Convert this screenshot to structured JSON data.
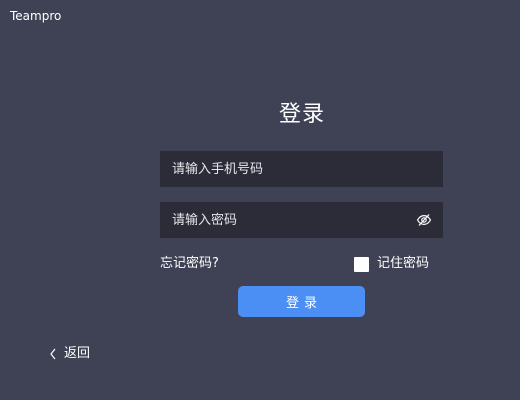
{
  "window": {
    "app_title": "Teampro"
  },
  "login": {
    "title": "登录",
    "phone_placeholder": "请输入手机号码",
    "phone_value": "",
    "password_placeholder": "请输入密码",
    "password_value": "",
    "password_toggle_icon": "eye-slash-icon",
    "forgot_password": "忘记密码?",
    "remember_password": "记住密码",
    "remember_checked": false,
    "submit_label": "登录"
  },
  "footer": {
    "back_icon": "chevron-left-icon",
    "back_label": "返回"
  },
  "colors": {
    "background": "#3f4254",
    "input_background": "#2c2c39",
    "primary_button": "#4b8ff5",
    "text": "#ffffff"
  }
}
